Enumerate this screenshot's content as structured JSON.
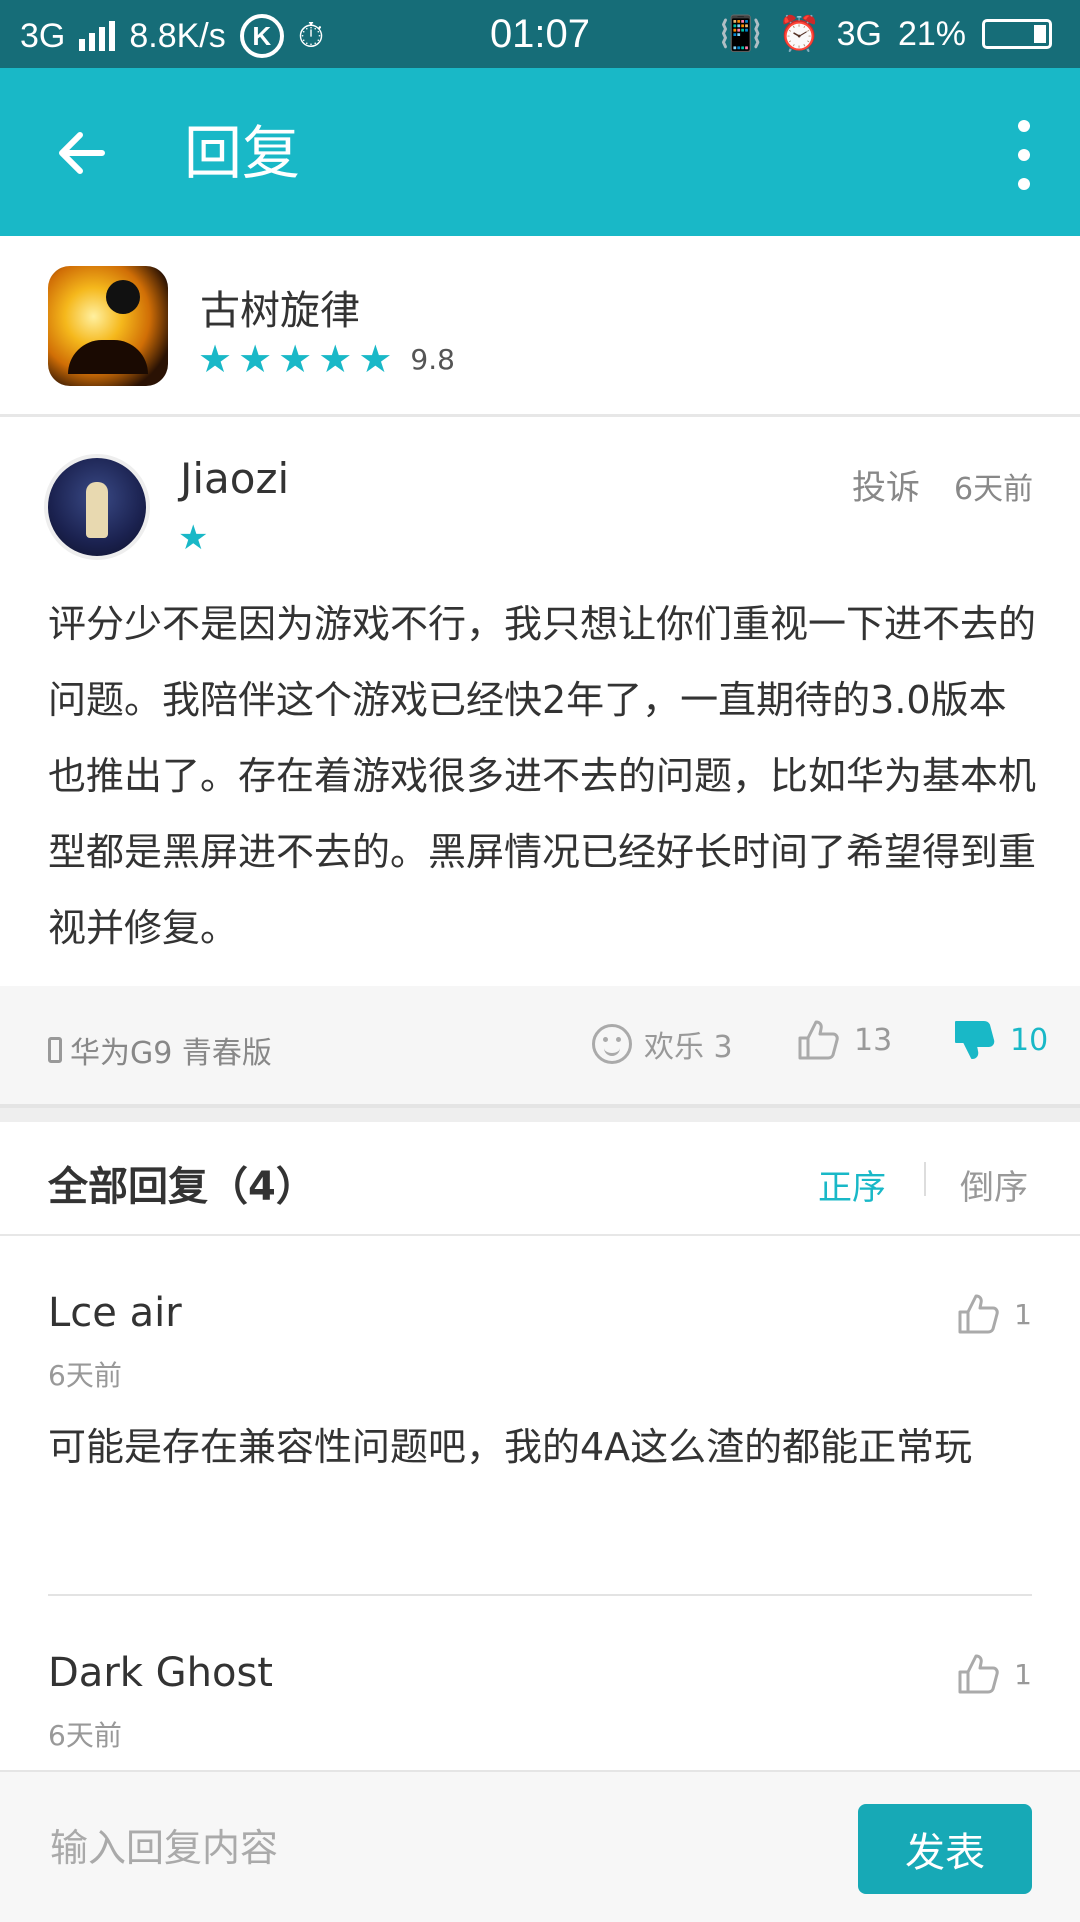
{
  "status_bar": {
    "network": "3G",
    "speed": "8.8K/s",
    "k_badge": "K",
    "time": "01:07",
    "network_right": "3G",
    "battery": "21%"
  },
  "app_bar": {
    "title": "回复",
    "back_icon": "arrow-left-icon",
    "menu_icon": "more-vertical-icon"
  },
  "app": {
    "name": "古树旋律",
    "stars": 5,
    "rating": "9.8"
  },
  "review": {
    "username": "Jiaozi",
    "stars": 1,
    "report_label": "投诉",
    "time_ago": "6天前",
    "body": "评分少不是因为游戏不行，我只想让你们重视一下进不去的问题。我陪伴这个游戏已经快2年了，一直期待的3.0版本也推出了。存在着游戏很多进不去的问题，比如华为基本机型都是黑屏进不去的。黑屏情况已经好长时间了希望得到重视并修复。",
    "device": "华为G9 青春版",
    "fun_label": "欢乐 3",
    "likes": "13",
    "dislikes": "10"
  },
  "replies": {
    "title": "全部回复（4）",
    "sort_asc": "正序",
    "sort_desc": "倒序",
    "items": [
      {
        "name": "Lce air",
        "time": "6天前",
        "likes": "1",
        "text": "可能是存在兼容性问题吧，我的4A这么渣的都能正常玩"
      },
      {
        "name": "Dark Ghost",
        "time": "6天前",
        "likes": "1",
        "text": ""
      }
    ]
  },
  "composer": {
    "placeholder": "输入回复内容",
    "submit_label": "发表"
  },
  "colors": {
    "accent": "#19b8c7",
    "status_bar": "#166d78"
  }
}
